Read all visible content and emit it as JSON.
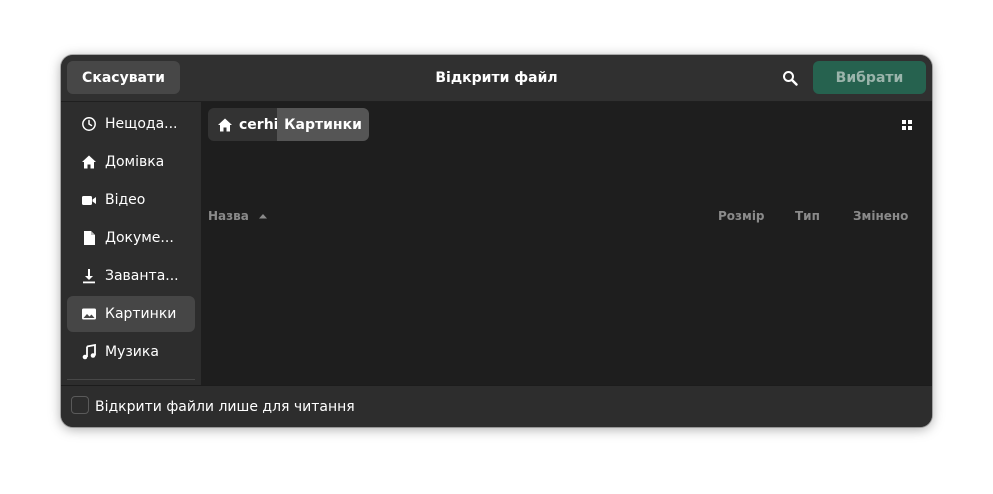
{
  "header": {
    "cancel_label": "Скасувати",
    "title": "Відкрити файл",
    "select_label": "Вибрати"
  },
  "sidebar": {
    "items": [
      {
        "label": "Нещода...",
        "icon": "clock-icon"
      },
      {
        "label": "Домівка",
        "icon": "home-icon"
      },
      {
        "label": "Відео",
        "icon": "video-icon"
      },
      {
        "label": "Докуме...",
        "icon": "document-icon"
      },
      {
        "label": "Заванта...",
        "icon": "download-icon"
      },
      {
        "label": "Картинки",
        "icon": "image-icon",
        "active": true
      },
      {
        "label": "Музика",
        "icon": "music-icon"
      }
    ]
  },
  "breadcrumb": {
    "home_label": "cerhiy",
    "current_label": "Картинки"
  },
  "columns": {
    "name": "Назва",
    "size": "Розмір",
    "type": "Тип",
    "modified": "Змінено"
  },
  "footer": {
    "readonly_label": "Відкрити файли лише для читання",
    "readonly_checked": false
  },
  "colors": {
    "accent": "#26624f",
    "background": "#2d2d2d",
    "content": "#1e1e1e"
  }
}
